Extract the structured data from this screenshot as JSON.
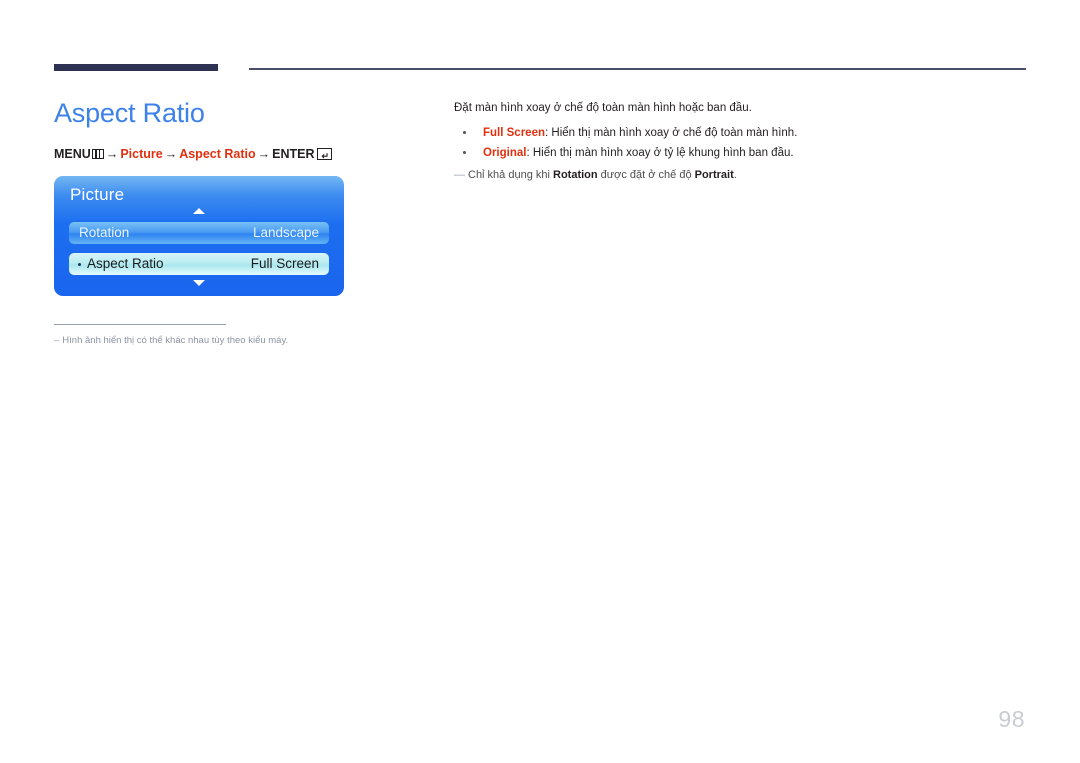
{
  "header": {
    "rule_thick_color": "#2d3152",
    "rule_thin_color": "#4b4e68"
  },
  "page": {
    "title": "Aspect Ratio",
    "title_color": "#3d82e8",
    "number": "98"
  },
  "breadcrumb": {
    "menu_label": "MENU",
    "menu_icon": "menu-grid-icon",
    "arrow": "→",
    "items": [
      {
        "label": "Picture",
        "color": "#e03010"
      },
      {
        "label": "Aspect Ratio",
        "color": "#e03010"
      }
    ],
    "enter_label": "ENTER",
    "enter_icon": "enter-return-icon"
  },
  "osd_menu": {
    "title": "Picture",
    "scroll_up_icon": "triangle-up-icon",
    "scroll_down_icon": "triangle-down-icon",
    "rows": [
      {
        "label": "Rotation",
        "value": "Landscape",
        "selected": false
      },
      {
        "label": "Aspect Ratio",
        "value": "Full Screen",
        "selected": true
      }
    ],
    "panel_color": "#1c6ef0",
    "selected_row_color": "#b9ecf2"
  },
  "left_footnote": {
    "dash": "–",
    "text": "Hình ảnh hiển thị có thể khác nhau tùy theo kiểu máy."
  },
  "description": {
    "intro": "Đặt màn hình xoay ở chế độ toàn màn hình hoặc ban đầu.",
    "bullets": [
      {
        "term": "Full Screen",
        "separator": ": ",
        "text": "Hiển thị màn hình xoay ở chế độ toàn màn hình."
      },
      {
        "term": "Original",
        "separator": ": ",
        "text": "Hiển thị màn hình xoay ở tỷ lệ khung hình ban đầu."
      }
    ],
    "note": {
      "dash": "―",
      "part1": "Chỉ khả dụng khi ",
      "term1": "Rotation",
      "part2": " được đặt ở chế độ ",
      "term2": "Portrait",
      "part3": "."
    }
  }
}
